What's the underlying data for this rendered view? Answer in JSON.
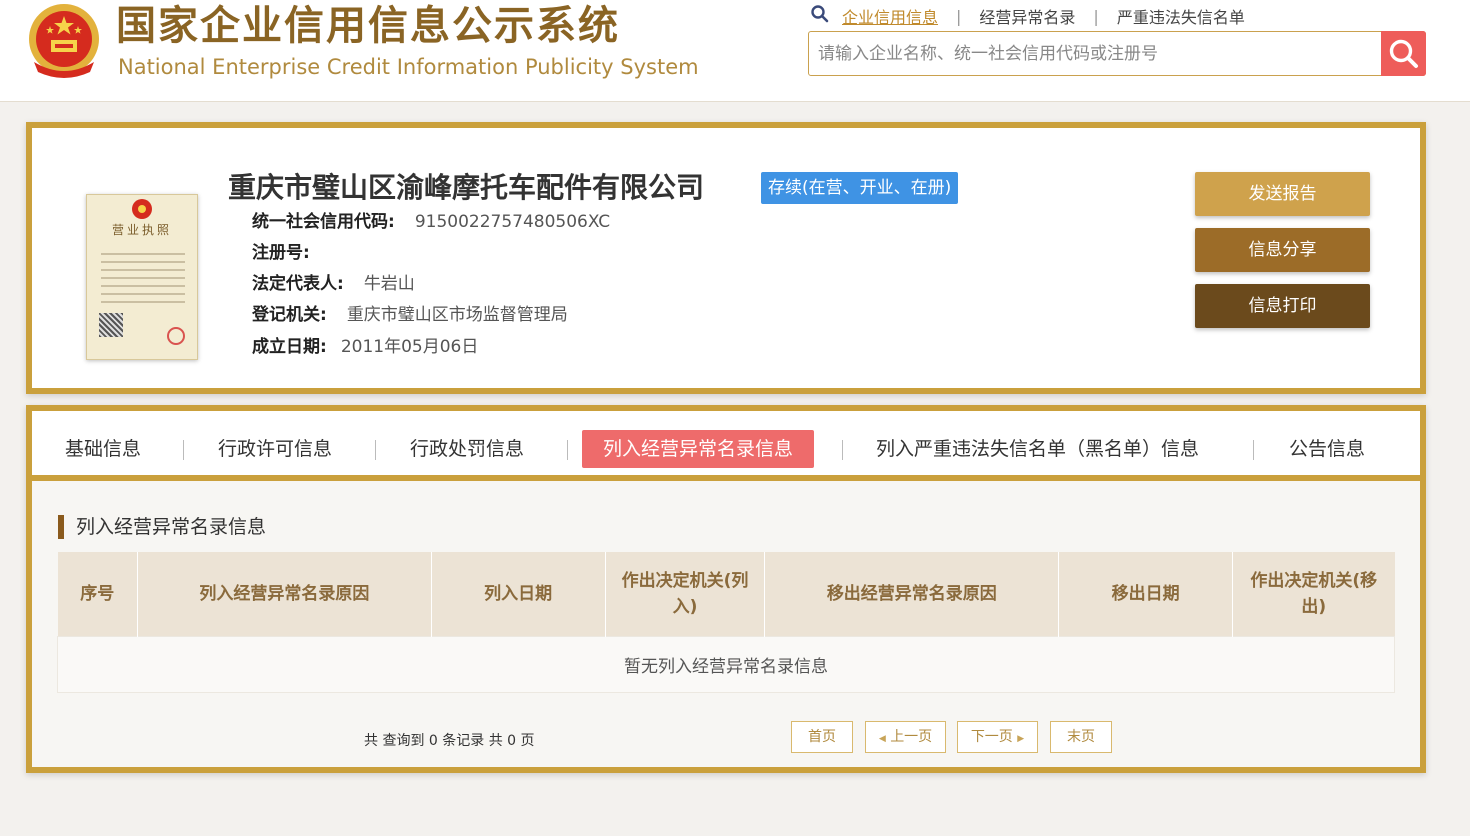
{
  "header": {
    "title_cn": "国家企业信用信息公示系统",
    "title_en": "National Enterprise Credit Information Publicity System",
    "links": [
      "企业信用信息",
      "经营异常名录",
      "严重违法失信名单"
    ],
    "search_placeholder": "请输入企业名称、统一社会信用代码或注册号",
    "icons": [
      "national-emblem-icon",
      "search-icon"
    ],
    "colors": {
      "brand": "#8a6424",
      "accent": "#caa03c",
      "search_button": "#ee5d5a"
    }
  },
  "company": {
    "name": "重庆市璧山区渝峰摩托车配件有限公司",
    "status": "存续(在营、开业、在册)",
    "license_caption": "营业执照",
    "fields": [
      {
        "label": "统一社会信用代码:",
        "value": "9150022757480506XC"
      },
      {
        "label": "注册号:",
        "value": ""
      },
      {
        "label": "法定代表人:",
        "value": "牛岩山"
      },
      {
        "label": "登记机关:",
        "value": "重庆市璧山区市场监督管理局"
      },
      {
        "label": "成立日期:",
        "value": "2011年05月06日"
      }
    ],
    "actions": [
      "发送报告",
      "信息分享",
      "信息打印"
    ],
    "colors": {
      "status_badge": "#3f93e4"
    }
  },
  "tabs": {
    "items": [
      "基础信息",
      "行政许可信息",
      "行政处罚信息",
      "列入经营异常名录信息",
      "列入严重违法失信名单（黑名单）信息",
      "公告信息"
    ],
    "active_index": 3,
    "active_color": "#ee6b6b"
  },
  "section": {
    "title": "列入经营异常名录信息",
    "columns": [
      "序号",
      "列入经营异常名录原因",
      "列入日期",
      "作出决定机关(列入)",
      "移出经营异常名录原因",
      "移出日期",
      "作出决定机关(移出)"
    ],
    "empty_text": "暂无列入经营异常名录信息"
  },
  "pager": {
    "summary": "共 查询到 0 条记录 共 0 页",
    "first": "首页",
    "prev": "上一页",
    "next": "下一页",
    "last": "末页"
  }
}
